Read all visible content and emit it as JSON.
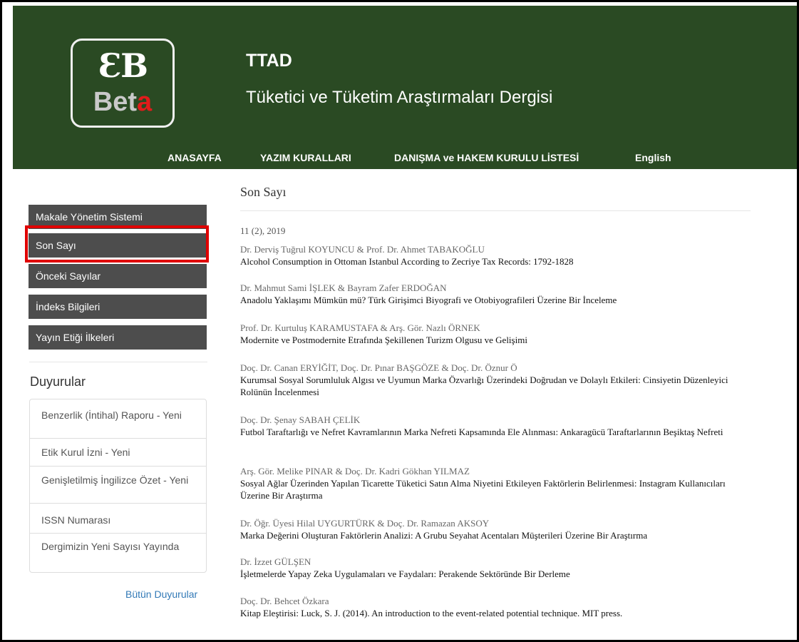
{
  "header": {
    "logo_mark": "ƐB",
    "logo_word_main": "Bet",
    "logo_word_accent": "a",
    "site_short": "TTAD",
    "site_full": "Tüketici ve Tüketim Araştırmaları Dergisi",
    "brand_color": "#2a4a23",
    "nav": [
      "ANASAYFA",
      "YAZIM KURALLARI",
      "DANIŞMA ve HAKEM KURULU LİSTESİ",
      "English"
    ]
  },
  "sidebar": {
    "menu": [
      "Makale Yönetim Sistemi",
      "Son Sayı",
      "Önceki Sayılar",
      "İndeks Bilgileri",
      "Yayın Etiği İlkeleri"
    ],
    "highlighted_item": "Son Sayı",
    "highlight_color": "#e00000",
    "announcements_title": "Duyurular",
    "announcements": [
      "Benzerlik (İntihal) Raporu - Yeni",
      "Etik Kurul İzni - Yeni",
      "Genişletilmiş İngilizce Özet - Yeni",
      "ISSN Numarası",
      "Dergimizin Yeni Sayısı Yayında"
    ],
    "all_announcements": "Bütün Duyurular"
  },
  "main": {
    "title": "Son Sayı",
    "issue": "11 (2), 2019",
    "articles": [
      {
        "authors": "Dr. Derviş Tuğrul KOYUNCU & Prof. Dr. Ahmet TABAKOĞLU",
        "title": "Alcohol Consumption in Ottoman Istanbul According to Zecriye Tax Records: 1792-1828"
      },
      {
        "authors": "Dr. Mahmut Sami İŞLEK & Bayram Zafer ERDOĞAN",
        "title": "Anadolu Yaklaşımı Mümkün mü? Türk Girişimci Biyografi ve Otobiyografileri Üzerine Bir İnceleme"
      },
      {
        "authors": "Prof. Dr. Kurtuluş KARAMUSTAFA & Arş. Gör. Nazlı ÖRNEK",
        "title": "Modernite ve Postmodernite Etrafında Şekillenen Turizm Olgusu ve Gelişimi"
      },
      {
        "authors": "Doç. Dr. Canan ERYİĞİT, Doç. Dr. Pınar BAŞGÖZE & Doç. Dr. Öznur Ö",
        "title": "Kurumsal Sosyal Sorumluluk Algısı ve Uyumun Marka Özvarlığı Üzerindeki Doğrudan ve Dolaylı Etkileri: Cinsiyetin Düzenleyici Rolünün İncelenmesi"
      },
      {
        "authors": "Doç. Dr. Şenay SABAH ÇELİK",
        "title": "Futbol Taraftarlığı ve Nefret Kavramlarının Marka Nefreti Kapsamında Ele Alınması: Ankaragücü Taraftarlarının Beşiktaş Nefreti"
      },
      {
        "authors": "Arş. Gör. Melike PINAR & Doç. Dr. Kadri Gökhan YILMAZ",
        "title": "Sosyal Ağlar Üzerinden Yapılan Ticarette Tüketici Satın Alma Niyetini Etkileyen Faktörlerin Belirlenmesi: Instagram Kullanıcıları Üzerine Bir Araştırma"
      },
      {
        "authors": "Dr. Öğr. Üyesi Hilal UYGURTÜRK & Doç. Dr. Ramazan AKSOY",
        "title": "Marka Değerini Oluşturan Faktörlerin Analizi: A Grubu Seyahat Acentaları Müşterileri Üzerine Bir Araştırma"
      },
      {
        "authors": "Dr. İzzet GÜLŞEN",
        "title": "İşletmelerde Yapay Zeka Uygulamaları ve Faydaları: Perakende Sektöründe Bir Derleme"
      },
      {
        "authors": "Doç. Dr. Behcet Özkara",
        "title": "Kitap Eleştirisi: Luck, S. J. (2014). An introduction to the event-related potential technique. MIT press."
      }
    ]
  }
}
